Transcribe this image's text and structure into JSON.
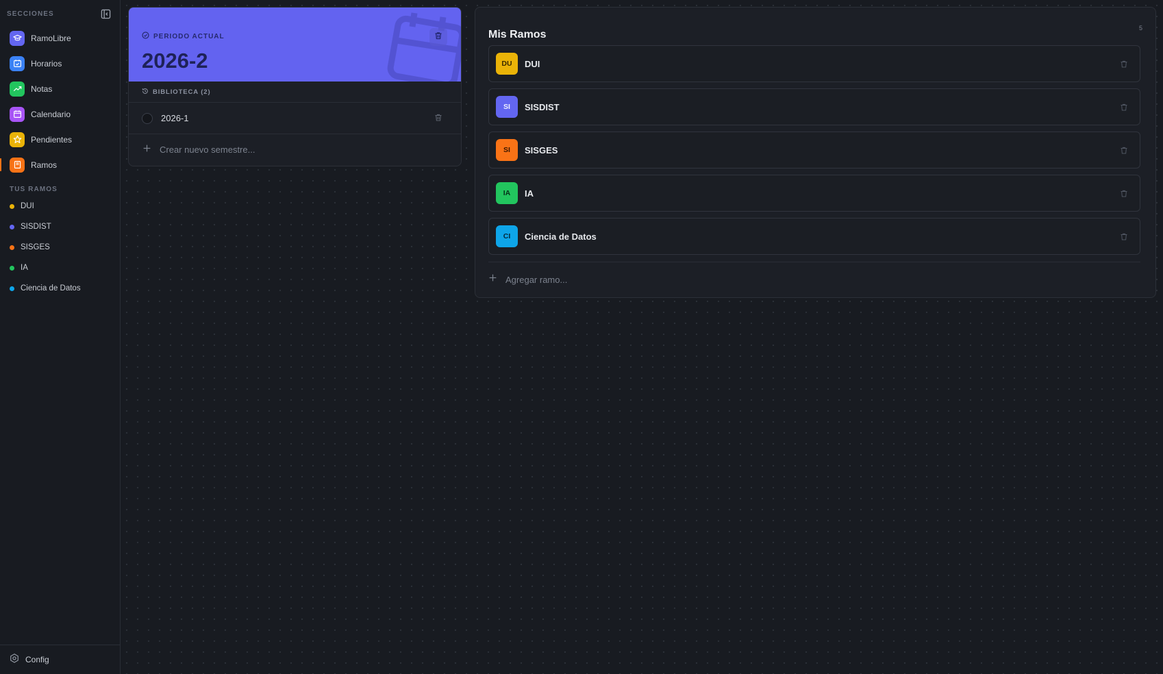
{
  "sidebar": {
    "section_label": "SECCIONES",
    "collapse_icon": "sidebar-collapse-icon",
    "nav": [
      {
        "label": "RamoLibre",
        "icon": "graduation-cap-icon",
        "color": "#6366f1",
        "active": false
      },
      {
        "label": "Horarios",
        "icon": "calendar-check-icon",
        "color": "#3b82f6",
        "active": false
      },
      {
        "label": "Notas",
        "icon": "trending-up-icon",
        "color": "#22c55e",
        "active": false
      },
      {
        "label": "Calendario",
        "icon": "calendar-icon",
        "color": "#a855f7",
        "active": false
      },
      {
        "label": "Pendientes",
        "icon": "star-icon",
        "color": "#eab308",
        "active": false
      },
      {
        "label": "Ramos",
        "icon": "book-icon",
        "color": "#f97316",
        "active": true
      }
    ],
    "courses_label": "TUS RAMOS",
    "courses": [
      {
        "label": "DUI",
        "color": "#eab308"
      },
      {
        "label": "SISDIST",
        "color": "#6366f1"
      },
      {
        "label": "SISGES",
        "color": "#f97316"
      },
      {
        "label": "IA",
        "color": "#22c55e"
      },
      {
        "label": "Ciencia de Datos",
        "color": "#0ea5e9"
      }
    ],
    "footer": {
      "label": "Config",
      "icon": "settings-icon"
    }
  },
  "semester": {
    "current_label": "PERIODO ACTUAL",
    "current_value": "2026-2",
    "hero_color": "#6363f0",
    "library_label": "BIBLIOTECA (2)",
    "items": [
      {
        "label": "2026-1"
      }
    ],
    "new_placeholder": "Crear nuevo semestre..."
  },
  "ramos": {
    "title": "Mis Ramos",
    "count": "5",
    "items": [
      {
        "abbr": "DU",
        "name": "DUI",
        "color": "#eab308",
        "text_color": "#3a2a00"
      },
      {
        "abbr": "SI",
        "name": "SISDIST",
        "color": "#6366f1",
        "text_color": "#eef0ff"
      },
      {
        "abbr": "SI",
        "name": "SISGES",
        "color": "#f97316",
        "text_color": "#3a1700"
      },
      {
        "abbr": "IA",
        "name": "IA",
        "color": "#22c55e",
        "text_color": "#06301a"
      },
      {
        "abbr": "CI",
        "name": "Ciencia de Datos",
        "color": "#0ea5e9",
        "text_color": "#03283b"
      }
    ],
    "add_placeholder": "Agregar ramo..."
  }
}
